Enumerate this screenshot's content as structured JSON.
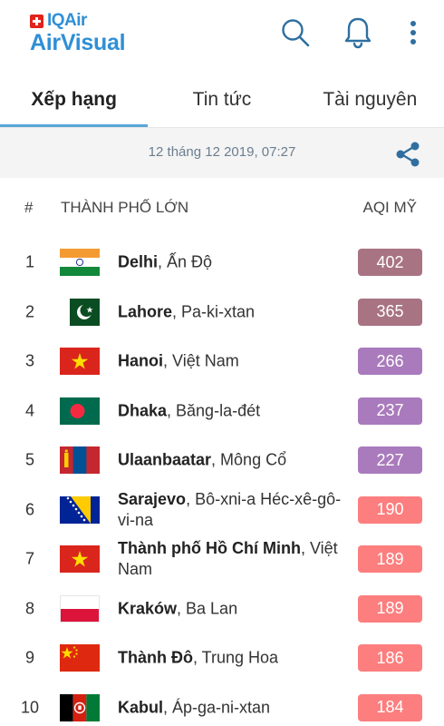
{
  "app": {
    "brand_top": "IQAir",
    "brand_main": "AirVisual",
    "icons": [
      "search-icon",
      "bell-icon",
      "more-vert-icon",
      "share-icon"
    ]
  },
  "tabs": [
    {
      "label": "Xếp hạng",
      "active": true
    },
    {
      "label": "Tin tức",
      "active": false
    },
    {
      "label": "Tài nguyên",
      "active": false
    }
  ],
  "timestamp": "12 tháng 12 2019, 07:27",
  "table": {
    "col_rank": "#",
    "col_city": "THÀNH PHỐ LỚN",
    "col_aqi": "AQI MỸ"
  },
  "colors": {
    "brand": "#2f8fd6",
    "hazardous": "#a87383",
    "very_unhealthy": "#a97abc",
    "unhealthy": "#fd7e7e"
  },
  "rows": [
    {
      "rank": "1",
      "city": "Delhi",
      "country": ", Ấn Độ",
      "aqi": "402",
      "flag": "india",
      "level": "hazardous"
    },
    {
      "rank": "2",
      "city": "Lahore",
      "country": ", Pa-ki-xtan",
      "aqi": "365",
      "flag": "pakistan",
      "level": "hazardous"
    },
    {
      "rank": "3",
      "city": "Hanoi",
      "country": ", Việt Nam",
      "aqi": "266",
      "flag": "vietnam",
      "level": "very_unhealthy"
    },
    {
      "rank": "4",
      "city": "Dhaka",
      "country": ", Băng-la-đét",
      "aqi": "237",
      "flag": "bangladesh",
      "level": "very_unhealthy"
    },
    {
      "rank": "5",
      "city": "Ulaanbaatar",
      "country": ", Mông Cổ",
      "aqi": "227",
      "flag": "mongolia",
      "level": "very_unhealthy"
    },
    {
      "rank": "6",
      "city": "Sarajevo",
      "country": ", Bô-xni-a Héc-xê-gô-vi-na",
      "aqi": "190",
      "flag": "bosnia",
      "level": "unhealthy"
    },
    {
      "rank": "7",
      "city": "Thành phố Hồ Chí Minh",
      "country": ", Việt Nam",
      "aqi": "189",
      "flag": "vietnam",
      "level": "unhealthy"
    },
    {
      "rank": "8",
      "city": "Kraków",
      "country": ", Ba Lan",
      "aqi": "189",
      "flag": "poland",
      "level": "unhealthy"
    },
    {
      "rank": "9",
      "city": "Thành Đô",
      "country": ", Trung Hoa",
      "aqi": "186",
      "flag": "china",
      "level": "unhealthy"
    },
    {
      "rank": "10",
      "city": "Kabul",
      "country": ", Áp-ga-ni-xtan",
      "aqi": "184",
      "flag": "afghanistan",
      "level": "unhealthy"
    }
  ]
}
